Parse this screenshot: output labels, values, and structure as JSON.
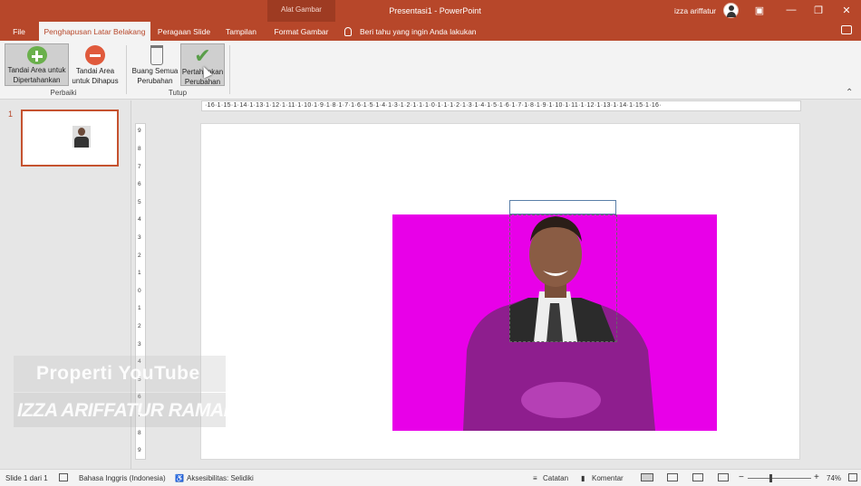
{
  "titlebar": {
    "context_group": "Alat Gambar",
    "document_title": "Presentasi1 - PowerPoint",
    "user_name": "izza ariffatur"
  },
  "tabs": [
    {
      "label": "File"
    },
    {
      "label": "Penghapusan Latar Belakang"
    },
    {
      "label": "Peragaan Slide"
    },
    {
      "label": "Tampilan"
    },
    {
      "label": "Format Gambar"
    }
  ],
  "tell_me": "Beri tahu yang ingin Anda lakukan",
  "ribbon": {
    "buttons": [
      {
        "line1": "Tandai Area untuk",
        "line2": "Dipertahankan"
      },
      {
        "line1": "Tandai Area",
        "line2": "untuk Dihapus"
      },
      {
        "line1": "Buang Semua",
        "line2": "Perubahan"
      },
      {
        "line1": "Pertahankan",
        "line2": "Perubahan"
      }
    ],
    "groups": [
      "Perbaiki",
      "Tutup"
    ]
  },
  "thumbnails": {
    "slide_number": "1"
  },
  "rulers": {
    "horizontal": "·16·1·15·1·14·1·13·1·12·1·11·1·10·1·9·1·8·1·7·1·6·1·5·1·4·1·3·1·2·1·1·1·0·1·1·1·2·1·3·1·4·1·5·1·6·1·7·1·8·1·9·1·10·1·11·1·12·1·13·1·14·1·15·1·16·",
    "vertical": [
      "9",
      "8",
      "7",
      "6",
      "5",
      "4",
      "3",
      "2",
      "1",
      "0",
      "1",
      "2",
      "3",
      "4",
      "5",
      "6",
      "7",
      "8",
      "9"
    ]
  },
  "watermark": {
    "line1": "Properti YouTube",
    "line2": "IZZA ARIFFATUR RAMADHANI"
  },
  "status": {
    "slide_info": "Slide 1 dari 1",
    "language": "Bahasa Inggris (Indonesia)",
    "accessibility": "Aksesibilitas: Selidiki",
    "notes": "Catatan",
    "comments": "Komentar",
    "zoom_level": "74%"
  },
  "colors": {
    "accent": "#b7472a",
    "removal_overlay": "#e800e8"
  }
}
